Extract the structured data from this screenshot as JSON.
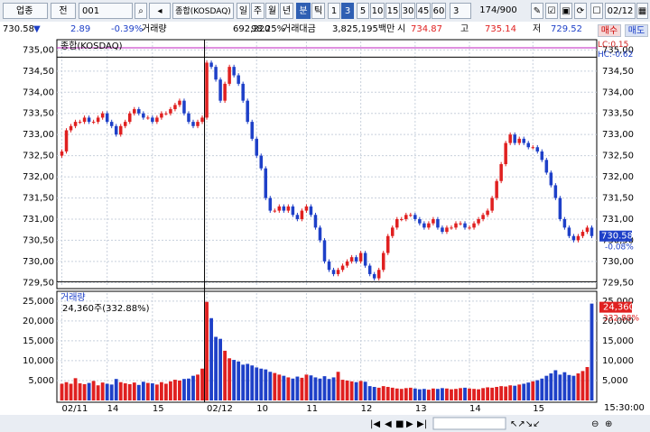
{
  "toolbar": {
    "sector_label": "업종",
    "market_label": "전",
    "code_value": "001",
    "index_name": "종합(KOSDAQ)",
    "periods": [
      "일",
      "주",
      "월",
      "년",
      "분",
      "틱"
    ],
    "intervals": [
      "1",
      "3",
      "5",
      "10",
      "15",
      "30",
      "45",
      "60"
    ],
    "interval_select": "3",
    "count": "174/900",
    "date": "02/12"
  },
  "info": {
    "price": "730.58",
    "change": "2.89",
    "change_pct": "-0.39%",
    "volume_label": "거래량",
    "volume": "692,220",
    "volume_ratio": "98.25%",
    "amount_label": "거래대금",
    "amount": "3,825,195백만",
    "open_label": "시",
    "open": "734.87",
    "high_label": "고",
    "high": "735.14",
    "low_label": "저",
    "low": "729.52",
    "buy": "매수",
    "sell": "매도"
  },
  "colors": {
    "up": "#e02020",
    "down": "#1e40c8",
    "grid": "#c8d0dc",
    "frame": "#000000"
  },
  "chart_data": [
    {
      "type": "line",
      "title": "종합(KOSDAQ)",
      "ylim": [
        729.4,
        735.2
      ],
      "yticks": [
        "735,00",
        "734,50",
        "734,00",
        "733,50",
        "733,00",
        "732,50",
        "732,00",
        "731,50",
        "731,00",
        "730,50",
        "730,00",
        "729,50"
      ],
      "ytick_values": [
        735.0,
        734.5,
        734.0,
        733.5,
        733.0,
        732.5,
        732.0,
        731.5,
        731.0,
        730.5,
        730.0,
        729.5
      ],
      "xticks": [
        "02/11",
        "14",
        "15",
        "02/12",
        "10",
        "11",
        "12",
        "13",
        "14",
        "15"
      ],
      "annotations": {
        "lc": "LC:0.15",
        "hc": "HC:-0.62",
        "last_price": "730.58",
        "last_pct": "-0.08%"
      },
      "hlines": [
        735.05,
        734.83,
        729.52
      ],
      "series": [
        {
          "values": [
            732.6,
            733.1,
            733.2,
            733.3,
            733.3,
            733.4,
            733.3,
            733.3,
            733.4,
            733.5,
            733.3,
            733.2,
            733.0,
            733.2,
            733.3,
            733.5,
            733.6,
            733.5,
            733.4,
            733.4,
            733.3,
            733.4,
            733.5,
            733.5,
            733.6,
            733.7,
            733.8,
            733.5,
            733.3,
            733.2,
            733.3,
            733.4,
            734.7,
            734.6,
            734.3,
            733.8,
            734.2,
            734.6,
            734.4,
            734.2,
            733.8,
            733.3,
            732.9,
            732.5,
            732.2,
            731.5,
            731.2,
            731.2,
            731.3,
            731.2,
            731.3,
            731.1,
            731.0,
            731.2,
            731.3,
            731.1,
            730.8,
            730.5,
            730.0,
            729.8,
            729.7,
            729.8,
            729.9,
            730.0,
            730.1,
            730.0,
            730.2,
            729.9,
            729.7,
            729.6,
            729.8,
            730.2,
            730.6,
            730.8,
            731.0,
            731.0,
            731.1,
            731.1,
            731.0,
            730.9,
            730.8,
            730.9,
            731.0,
            730.8,
            730.7,
            730.8,
            730.8,
            730.9,
            730.9,
            730.8,
            730.8,
            730.9,
            731.0,
            731.1,
            731.2,
            731.5,
            731.9,
            732.3,
            732.8,
            733.0,
            732.8,
            732.9,
            732.8,
            732.7,
            732.7,
            732.6,
            732.4,
            732.1,
            731.8,
            731.5,
            731.0,
            730.8,
            730.6,
            730.5,
            730.6,
            730.7,
            730.8,
            730.6
          ]
        }
      ]
    },
    {
      "type": "bar",
      "title": "거래량",
      "legend_value": "24,360주(332.88%)",
      "last_value": "24,360",
      "last_pct": "332.88%",
      "ylim": [
        0,
        27000
      ],
      "yticks": [
        "25,000",
        "20,000",
        "15,000",
        "10,000",
        "5,000"
      ],
      "ytick_values": [
        25000,
        20000,
        15000,
        10000,
        5000
      ],
      "time_label": "15:30:00",
      "series": [
        {
          "values": [
            4200,
            4600,
            4200,
            5600,
            4300,
            4100,
            4400,
            4900,
            3800,
            4500,
            4200,
            4000,
            5400,
            4600,
            4300,
            4100,
            4500,
            3900,
            4700,
            4400,
            4300,
            4000,
            4600,
            4200,
            4800,
            5200,
            5000,
            5400,
            5500,
            6200,
            6500,
            8000,
            24800,
            20700,
            16000,
            15500,
            12500,
            10600,
            10200,
            9800,
            9000,
            9200,
            8800,
            8300,
            8000,
            7800,
            7200,
            6900,
            6500,
            6200,
            5800,
            5500,
            6000,
            5700,
            6500,
            6300,
            5800,
            5500,
            6100,
            5400,
            5800,
            7200,
            5200,
            5000,
            4800,
            4600,
            4900,
            4700,
            3600,
            3400,
            3200,
            3600,
            3400,
            3200,
            3000,
            2900,
            3100,
            3200,
            3000,
            2800,
            2900,
            2700,
            3000,
            2900,
            3100,
            3000,
            2800,
            2900,
            3100,
            3200,
            3000,
            2900,
            2800,
            3100,
            3300,
            3200,
            3400,
            3600,
            3500,
            3800,
            3700,
            4000,
            4200,
            4500,
            4800,
            5100,
            5500,
            6200,
            6800,
            7600,
            6500,
            7100,
            6400,
            6200,
            6800,
            7400,
            8400,
            24360
          ]
        }
      ]
    }
  ]
}
